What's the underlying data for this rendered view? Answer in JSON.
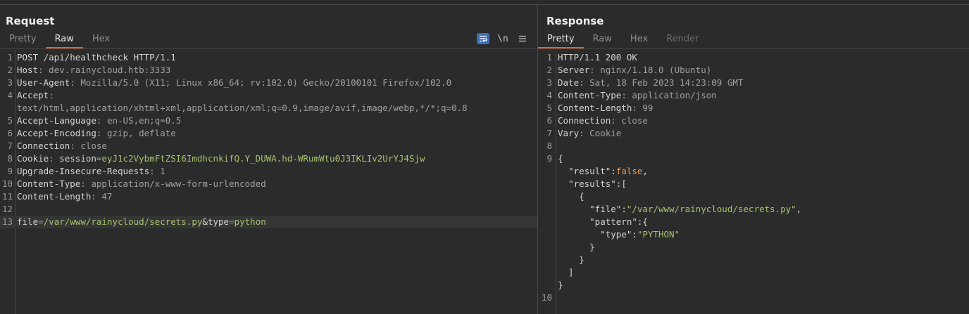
{
  "request": {
    "title": "Request",
    "tabs": [
      "Pretty",
      "Raw",
      "Hex"
    ],
    "tools": {
      "wrap": "wrap-lines-icon",
      "newline": "\\n",
      "menu": "menu-icon"
    },
    "lines": [
      {
        "n": "1",
        "parts": [
          {
            "t": "POST /api/healthcheck HTTP/1.1",
            "c": "k"
          }
        ]
      },
      {
        "n": "2",
        "parts": [
          {
            "t": "Host",
            "c": "k"
          },
          {
            "t": ": dev.rainycloud.htb:3333",
            "c": "v"
          }
        ]
      },
      {
        "n": "3",
        "parts": [
          {
            "t": "User-Agent",
            "c": "k"
          },
          {
            "t": ": Mozilla/5.0 (X11; Linux x86_64; rv:102.0) Gecko/20100101 Firefox/102.0",
            "c": "v"
          }
        ]
      },
      {
        "n": "4",
        "parts": [
          {
            "t": "Accept",
            "c": "k"
          },
          {
            "t": ":",
            "c": "v"
          }
        ]
      },
      {
        "n": "",
        "parts": [
          {
            "t": "text/html,application/xhtml+xml,application/xml;q=0.9,image/avif,image/webp,*/*;q=0.8",
            "c": "v"
          }
        ]
      },
      {
        "n": "5",
        "parts": [
          {
            "t": "Accept-Language",
            "c": "k"
          },
          {
            "t": ": en-US,en;q=0.5",
            "c": "v"
          }
        ]
      },
      {
        "n": "6",
        "parts": [
          {
            "t": "Accept-Encoding",
            "c": "k"
          },
          {
            "t": ": gzip, deflate",
            "c": "v"
          }
        ]
      },
      {
        "n": "7",
        "parts": [
          {
            "t": "Connection",
            "c": "k"
          },
          {
            "t": ": close",
            "c": "v"
          }
        ]
      },
      {
        "n": "8",
        "parts": [
          {
            "t": "Cookie",
            "c": "k"
          },
          {
            "t": ": ",
            "c": "v"
          },
          {
            "t": "session",
            "c": "k"
          },
          {
            "t": "=",
            "c": "v"
          },
          {
            "t": "eyJ1c2VybmFtZSI6ImdhcnkifQ.Y_DUWA.hd-WRumWtu0J3IKLIv2UrYJ4Sjw",
            "c": "g"
          }
        ]
      },
      {
        "n": "9",
        "parts": [
          {
            "t": "Upgrade-Insecure-Requests",
            "c": "k"
          },
          {
            "t": ": 1",
            "c": "v"
          }
        ]
      },
      {
        "n": "10",
        "parts": [
          {
            "t": "Content-Type",
            "c": "k"
          },
          {
            "t": ": application/x-www-form-urlencoded",
            "c": "v"
          }
        ]
      },
      {
        "n": "11",
        "parts": [
          {
            "t": "Content-Length",
            "c": "k"
          },
          {
            "t": ": 47",
            "c": "v"
          }
        ]
      },
      {
        "n": "12",
        "parts": []
      },
      {
        "n": "13",
        "hl": true,
        "parts": [
          {
            "t": "file",
            "c": "k"
          },
          {
            "t": "=",
            "c": "v"
          },
          {
            "t": "/var/www/rainycloud/secrets.py",
            "c": "g"
          },
          {
            "t": "&type",
            "c": "k"
          },
          {
            "t": "=",
            "c": "v"
          },
          {
            "t": "python",
            "c": "g"
          }
        ]
      }
    ]
  },
  "response": {
    "title": "Response",
    "tabs": [
      "Pretty",
      "Raw",
      "Hex",
      "Render"
    ],
    "lines": [
      {
        "n": "1",
        "parts": [
          {
            "t": "HTTP/1.1 200 OK",
            "c": "k"
          }
        ]
      },
      {
        "n": "2",
        "parts": [
          {
            "t": "Server",
            "c": "k"
          },
          {
            "t": ": nginx/1.18.0 (Ubuntu)",
            "c": "v"
          }
        ]
      },
      {
        "n": "3",
        "parts": [
          {
            "t": "Date",
            "c": "k"
          },
          {
            "t": ": Sat, 18 Feb 2023 14:23:09 GMT",
            "c": "v"
          }
        ]
      },
      {
        "n": "4",
        "parts": [
          {
            "t": "Content-Type",
            "c": "k"
          },
          {
            "t": ": application/json",
            "c": "v"
          }
        ]
      },
      {
        "n": "5",
        "parts": [
          {
            "t": "Content-Length",
            "c": "k"
          },
          {
            "t": ": 99",
            "c": "v"
          }
        ]
      },
      {
        "n": "6",
        "parts": [
          {
            "t": "Connection",
            "c": "k"
          },
          {
            "t": ": close",
            "c": "v"
          }
        ]
      },
      {
        "n": "7",
        "parts": [
          {
            "t": "Vary",
            "c": "k"
          },
          {
            "t": ": Cookie",
            "c": "v"
          }
        ]
      },
      {
        "n": "8",
        "parts": []
      },
      {
        "n": "9",
        "parts": [
          {
            "t": "{",
            "c": "w"
          }
        ]
      },
      {
        "n": "",
        "parts": [
          {
            "t": "  ",
            "c": "w"
          },
          {
            "t": "\"result\"",
            "c": "w"
          },
          {
            "t": ":",
            "c": "w"
          },
          {
            "t": "false",
            "c": "o"
          },
          {
            "t": ",",
            "c": "w"
          }
        ]
      },
      {
        "n": "",
        "parts": [
          {
            "t": "  ",
            "c": "w"
          },
          {
            "t": "\"results\"",
            "c": "w"
          },
          {
            "t": ":[",
            "c": "w"
          }
        ]
      },
      {
        "n": "",
        "parts": [
          {
            "t": "    {",
            "c": "w"
          }
        ]
      },
      {
        "n": "",
        "parts": [
          {
            "t": "      ",
            "c": "w"
          },
          {
            "t": "\"file\"",
            "c": "w"
          },
          {
            "t": ":",
            "c": "w"
          },
          {
            "t": "\"/var/www/rainycloud/secrets.py\"",
            "c": "g"
          },
          {
            "t": ",",
            "c": "w"
          }
        ]
      },
      {
        "n": "",
        "parts": [
          {
            "t": "      ",
            "c": "w"
          },
          {
            "t": "\"pattern\"",
            "c": "w"
          },
          {
            "t": ":{",
            "c": "w"
          }
        ]
      },
      {
        "n": "",
        "parts": [
          {
            "t": "        ",
            "c": "w"
          },
          {
            "t": "\"type\"",
            "c": "w"
          },
          {
            "t": ":",
            "c": "w"
          },
          {
            "t": "\"PYTHON\"",
            "c": "g"
          }
        ]
      },
      {
        "n": "",
        "parts": [
          {
            "t": "      }",
            "c": "w"
          }
        ]
      },
      {
        "n": "",
        "parts": [
          {
            "t": "    }",
            "c": "w"
          }
        ]
      },
      {
        "n": "",
        "parts": [
          {
            "t": "  ]",
            "c": "w"
          }
        ]
      },
      {
        "n": "",
        "parts": [
          {
            "t": "}",
            "c": "w"
          }
        ]
      },
      {
        "n": "10",
        "parts": []
      }
    ]
  }
}
